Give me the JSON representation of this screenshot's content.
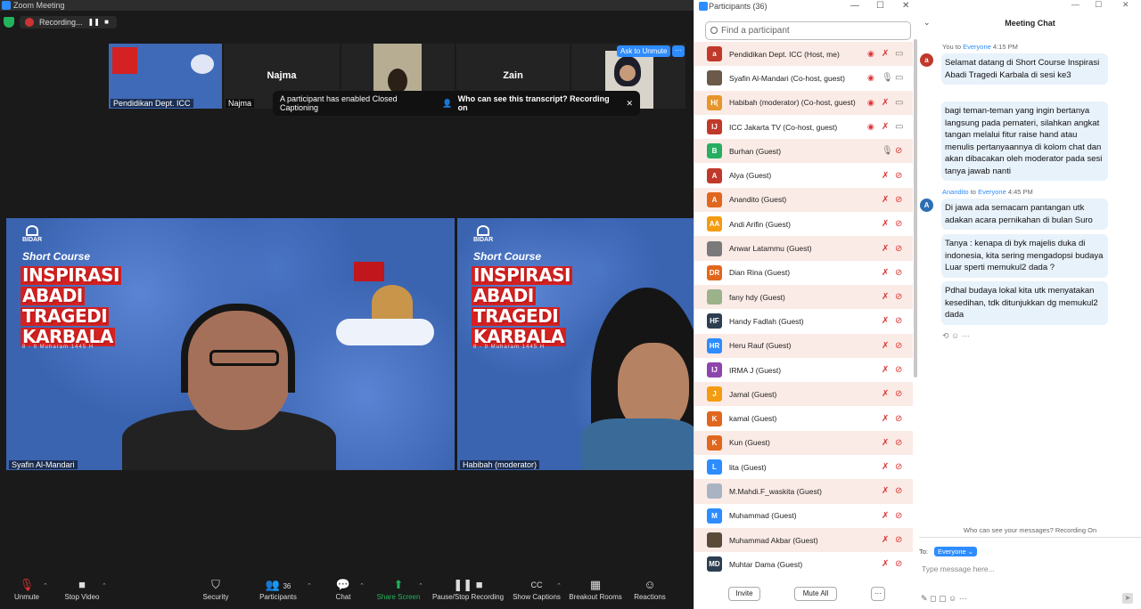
{
  "zoom": {
    "title": "Zoom Meeting",
    "recording_label": "Recording...",
    "thumbnails": [
      {
        "name": "Pendidikan Dept. ICC",
        "label": "Pendidikan Dept. ICC"
      },
      {
        "name": "Najma",
        "label": "Najma"
      },
      {
        "name": "",
        "label": ""
      },
      {
        "name": "Zain",
        "label": ""
      },
      {
        "name": "",
        "label": ""
      }
    ],
    "ask_to_unmute": "Ask to Unmute",
    "more_label": "···",
    "cc_banner": {
      "text": "A participant has enabled Closed Captioning",
      "link": "Who can see this transcript? Recording on",
      "close": "✕"
    },
    "videos": [
      {
        "label": "Syafin Al-Mandari",
        "bidar": "BIDAR",
        "short_course": "Short Course",
        "title_lines": [
          "INSPIRASI",
          "ABADI",
          "TRAGEDI",
          "KARBALA"
        ],
        "date": "8 - 9 Muharam 1445 H"
      },
      {
        "label": "Habibah (moderator)",
        "bidar": "BIDAR",
        "short_course": "Short Course",
        "title_lines": [
          "INSPIRASI",
          "ABADI",
          "TRAGEDI",
          "KARBALA"
        ],
        "date": "8 - 9 Muharam 1445 H"
      }
    ],
    "toolbar": {
      "unmute": "Unmute",
      "stop_video": "Stop Video",
      "security": "Security",
      "participants": "Participants",
      "participants_count": "36",
      "chat": "Chat",
      "share_screen": "Share Screen",
      "pause_recording": "Pause/Stop Recording",
      "show_captions": "Show Captions",
      "breakout_rooms": "Breakout Rooms",
      "reactions": "Reactions"
    }
  },
  "participants": {
    "title": "Participants (36)",
    "search_placeholder": "Find a participant",
    "list": [
      {
        "initials": "a",
        "color": "#c0392b",
        "name": "Pendidikan Dept. ICC (Host, me)"
      },
      {
        "initials": "",
        "color": "#6b5a4a",
        "name": "Syafin Al-Mandari (Co-host, guest)"
      },
      {
        "initials": "H(",
        "color": "#e6962b",
        "name": "Habibah (moderator) (Co-host, guest)"
      },
      {
        "initials": "IJ",
        "color": "#c0392b",
        "name": "ICC Jakarta TV (Co-host, guest)"
      },
      {
        "initials": "B",
        "color": "#27ae60",
        "name": "Burhan (Guest)"
      },
      {
        "initials": "A",
        "color": "#c0392b",
        "name": "Alya (Guest)"
      },
      {
        "initials": "A",
        "color": "#e0671d",
        "name": "Anandito (Guest)"
      },
      {
        "initials": "AA",
        "color": "#f39c12",
        "name": "Andi Arifin (Guest)"
      },
      {
        "initials": "",
        "color": "#7a7a7a",
        "name": "Anwar Latammu (Guest)"
      },
      {
        "initials": "DR",
        "color": "#e0671d",
        "name": "Dian Rina (Guest)"
      },
      {
        "initials": "",
        "color": "#9bb28a",
        "name": "fany hdy (Guest)"
      },
      {
        "initials": "HF",
        "color": "#2c3e50",
        "name": "Handy Fadlah (Guest)"
      },
      {
        "initials": "HR",
        "color": "#2d8cff",
        "name": "Heru Rauf (Guest)"
      },
      {
        "initials": "IJ",
        "color": "#8e44ad",
        "name": "IRMA J (Guest)"
      },
      {
        "initials": "J",
        "color": "#f39c12",
        "name": "Jamal (Guest)"
      },
      {
        "initials": "K",
        "color": "#e0671d",
        "name": "kamal (Guest)"
      },
      {
        "initials": "K",
        "color": "#e0671d",
        "name": "Kun (Guest)"
      },
      {
        "initials": "L",
        "color": "#2d8cff",
        "name": "lita (Guest)"
      },
      {
        "initials": "",
        "color": "#a9b4c2",
        "name": "M.Mahdi.F_waskita (Guest)"
      },
      {
        "initials": "M",
        "color": "#2d8cff",
        "name": "Muhammad (Guest)"
      },
      {
        "initials": "",
        "color": "#5a4a3a",
        "name": "Muhammad Akbar (Guest)"
      },
      {
        "initials": "MD",
        "color": "#2c3e50",
        "name": "Muhtar Dama (Guest)"
      }
    ],
    "invite": "Invite",
    "mute_all": "Mute All",
    "more": "···"
  },
  "chat": {
    "title": "Meeting Chat",
    "messages": [
      {
        "from": "You",
        "to": "Everyone",
        "time": "4:15 PM",
        "avatar": "a",
        "avatar_color": "#c0392b",
        "bubbles": [
          "Selamat datang di Short Course Inspirasi Abadi Tragedi Karbala di sesi ke3",
          "bagi teman-teman yang ingin bertanya langsung pada pemateri, silahkan angkat tangan melalui fitur raise hand atau menulis pertanyaannya di kolom chat dan akan dibacakan oleh moderator pada sesi tanya jawab nanti"
        ]
      },
      {
        "from": "Anandito",
        "to": "Everyone",
        "time": "4:45 PM",
        "avatar": "A",
        "avatar_color": "#2d6fb3",
        "bubbles": [
          "Di jawa ada semacam pantangan utk adakan acara pernikahan di bulan Suro",
          "Tanya : kenapa di byk majelis duka di indonesia, kita sering mengadopsi budaya Luar sperti memukul2 dada ?",
          "Pdhal budaya lokal kita utk menyatakan kesedihan, tdk ditunjukkan dg memukul2 dada"
        ]
      }
    ],
    "to_word": "to",
    "notice": "Who can see your messages? Recording On",
    "to_label": "To:",
    "everyone_btn": "Everyone ⌄",
    "input_placeholder": "Type message here...",
    "tools": "✎  ◻  ▢  ☺  ···"
  }
}
